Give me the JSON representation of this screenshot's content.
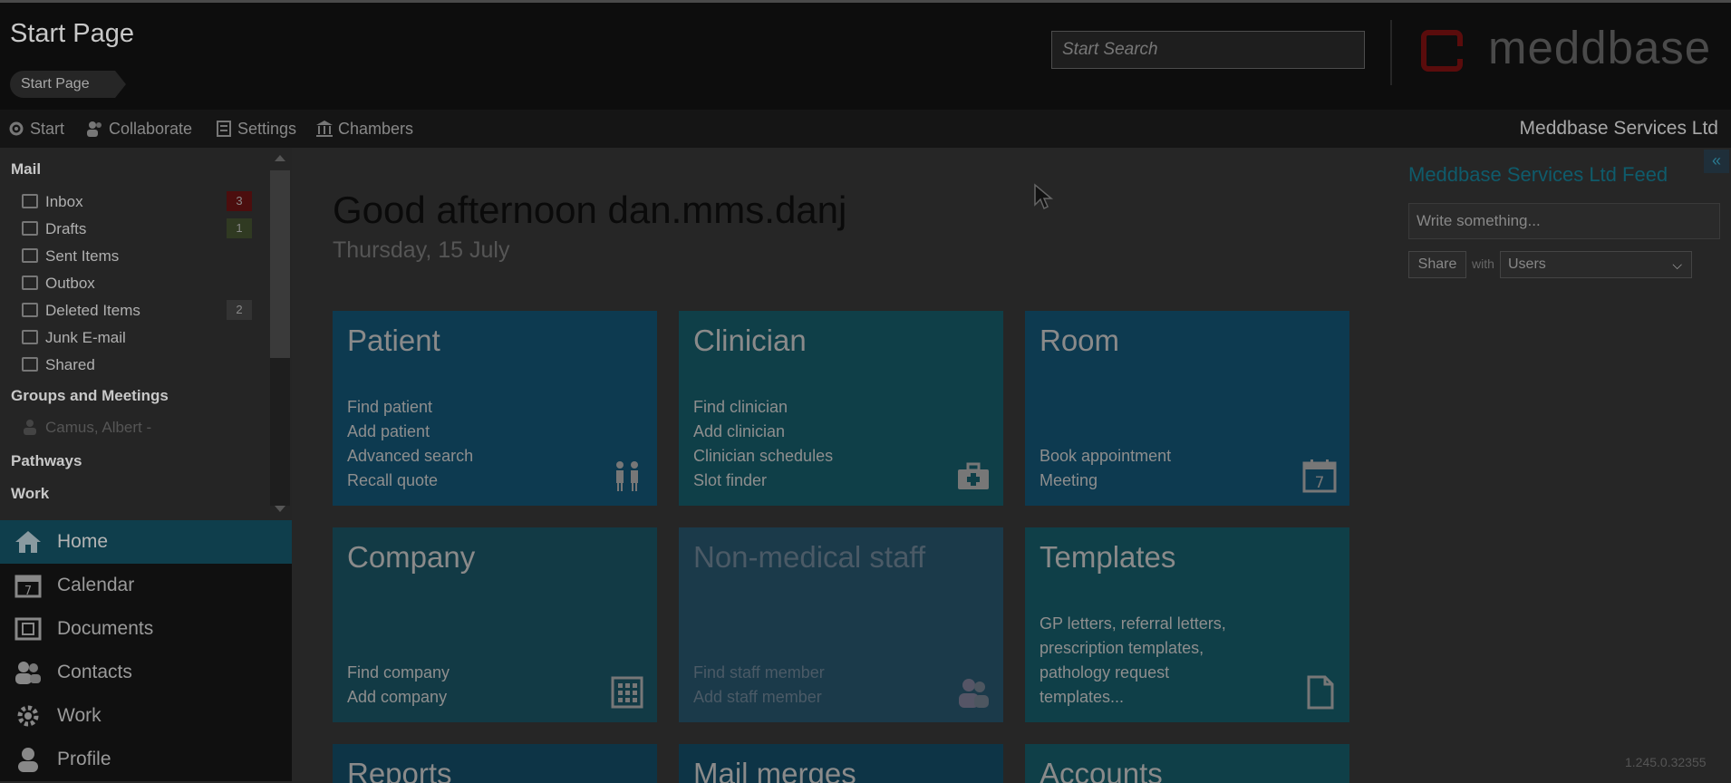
{
  "header": {
    "page_title": "Start Page",
    "breadcrumb": "Start Page",
    "search_placeholder": "Start Search",
    "logo_text": "meddbase"
  },
  "navbar": {
    "items": [
      "Start",
      "Collaborate",
      "Settings",
      "Chambers"
    ],
    "org_name": "Meddbase Services Ltd"
  },
  "sidebar": {
    "mail_header": "Mail",
    "folders": [
      {
        "label": "Inbox",
        "badge": "3"
      },
      {
        "label": "Drafts",
        "badge": "1"
      },
      {
        "label": "Sent Items",
        "badge": ""
      },
      {
        "label": "Outbox",
        "badge": ""
      },
      {
        "label": "Deleted Items",
        "badge": "2"
      },
      {
        "label": "Junk E-mail",
        "badge": ""
      },
      {
        "label": "Shared",
        "badge": ""
      }
    ],
    "groups_header": "Groups and Meetings",
    "group_item": "Camus, Albert -",
    "pathways_header": "Pathways",
    "work_header": "Work"
  },
  "modules": [
    "Home",
    "Calendar",
    "Documents",
    "Contacts",
    "Work",
    "Profile"
  ],
  "main": {
    "greeting": "Good afternoon dan.mms.danj",
    "date": "Thursday, 15 July"
  },
  "tiles": [
    {
      "title": "Patient",
      "links": [
        "Find patient",
        "Add patient",
        "Advanced search",
        "Recall quote"
      ],
      "icon": "people-icon",
      "color": "#0d3a50"
    },
    {
      "title": "Clinician",
      "links": [
        "Find clinician",
        "Add clinician",
        "Clinician schedules",
        "Slot finder"
      ],
      "icon": "medical-bag-icon",
      "color": "#0f3f48"
    },
    {
      "title": "Room",
      "links": [
        "Book appointment",
        "Meeting"
      ],
      "icon": "calendar-icon",
      "color": "#0d3a50"
    },
    {
      "title": "Company",
      "links": [
        "Find company",
        "Add company"
      ],
      "icon": "building-icon",
      "color": "#123a45"
    },
    {
      "title": "Non-medical staff",
      "links": [
        "Find staff member",
        "Add staff member"
      ],
      "icon": "staff-icon",
      "color": "#1b3a4a"
    },
    {
      "title": "Templates",
      "links": [
        "GP letters, referral letters,",
        "prescription templates,",
        "pathology request",
        "templates..."
      ],
      "icon": "document-icon",
      "color": "#0f3f48"
    },
    {
      "title": "Reports",
      "links": [],
      "icon": "",
      "color": "#0d3446"
    },
    {
      "title": "Mail merges",
      "links": [],
      "icon": "",
      "color": "#0d3446"
    },
    {
      "title": "Accounts",
      "links": [],
      "icon": "",
      "color": "#0f3f48"
    }
  ],
  "feed": {
    "title": "Meddbase Services Ltd Feed",
    "collapse_label": "«",
    "input_placeholder": "Write something...",
    "share_label": "Share",
    "with_label": "with",
    "audience_selected": "Users"
  },
  "version": "1.245.0.32355"
}
